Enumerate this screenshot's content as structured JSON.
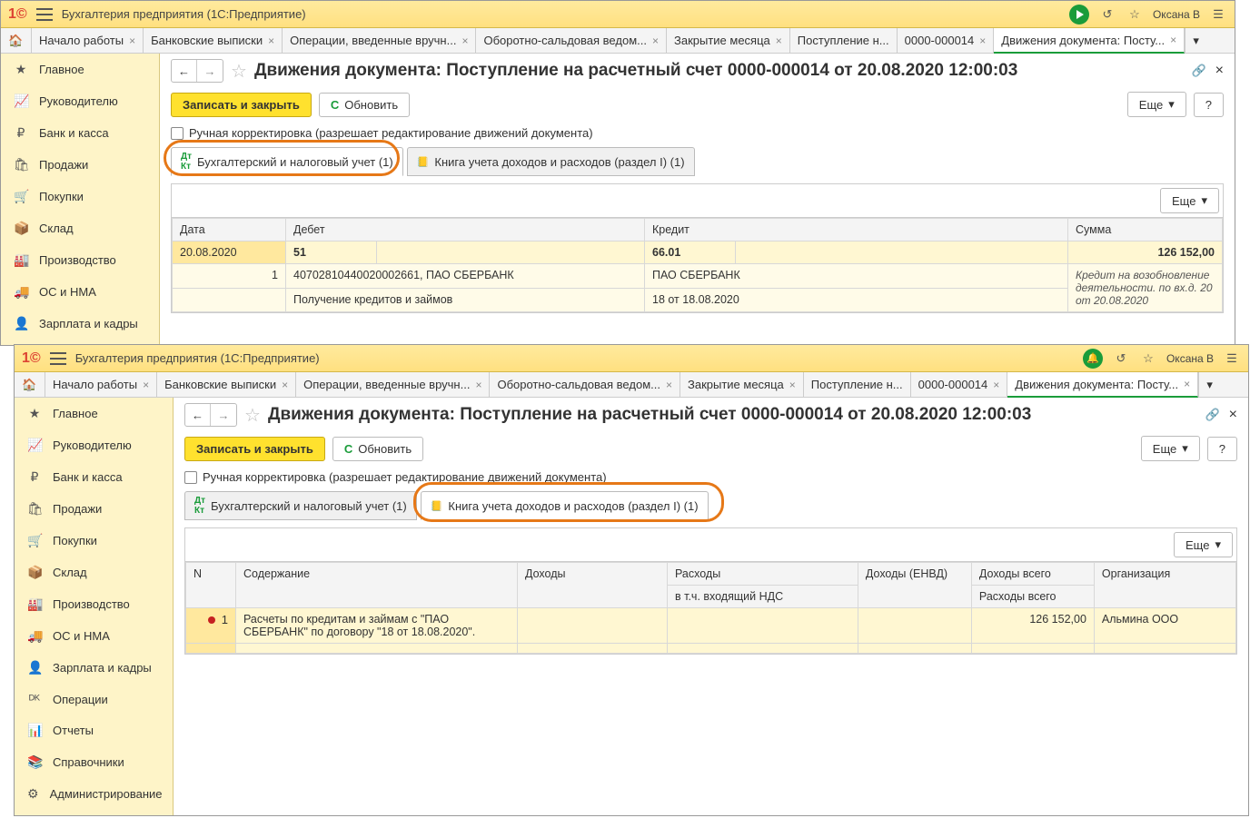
{
  "app": {
    "title": "Бухгалтерия предприятия   (1С:Предприятие)",
    "user": "Оксана В"
  },
  "tabs": [
    "Начало работы",
    "Банковские выписки",
    "Операции, введенные вручн...",
    "Оборотно-сальдовая ведом...",
    "Закрытие месяца",
    "Поступление н...",
    "0000-000014",
    "Движения документа: Посту..."
  ],
  "sidebar": [
    "Главное",
    "Руководителю",
    "Банк и касса",
    "Продажи",
    "Покупки",
    "Склад",
    "Производство",
    "ОС и НМА",
    "Зарплата и кадры",
    "Операции",
    "Отчеты",
    "Справочники",
    "Администрирование"
  ],
  "sbicons": [
    "★",
    "📈",
    "₽",
    "🛍",
    "🛒",
    "📦",
    "🏭",
    "🚚",
    "👤",
    "ᴰᴷ",
    "📊",
    "📚",
    "⚙"
  ],
  "page": {
    "title": "Движения документа: Поступление на расчетный счет 0000-000014 от 20.08.2020 12:00:03",
    "save": "Записать и закрыть",
    "refresh": "Обновить",
    "more": "Еще",
    "help": "?",
    "manual": "Ручная корректировка (разрешает редактирование движений документа)",
    "subtab1": "Бухгалтерский и налоговый учет (1)",
    "subtab2": "Книга учета доходов и расходов (раздел I) (1)"
  },
  "t1": {
    "h": [
      "Дата",
      "Дебет",
      "",
      "Кредит",
      "",
      "Сумма"
    ],
    "date": "20.08.2020",
    "idx": "1",
    "debet": "51",
    "kredit": "66.01",
    "sum": "126 152,00",
    "d_acc": "40702810440020002661, ПАО СБЕРБАНК",
    "k_acc": "ПАО СБЕРБАНК",
    "d_op": "Получение кредитов и займов",
    "k_doc": "18 от 18.08.2020",
    "note": "Кредит на возобновление деятельности. по вх.д. 20 от 20.08.2020"
  },
  "t2": {
    "h": [
      "N",
      "Содержание",
      "Доходы",
      "Расходы",
      "Доходы (ЕНВД)",
      "Доходы всего",
      "Организация"
    ],
    "h2": [
      "",
      "",
      "",
      "в т.ч. входящий НДС",
      "",
      "Расходы всего",
      ""
    ],
    "n": "1",
    "cont": "Расчеты по кредитам и займам с \"ПАО СБЕРБАНК\" по договору \"18 от 18.08.2020\".",
    "dv": "126 152,00",
    "org": "Альмина ООО"
  }
}
